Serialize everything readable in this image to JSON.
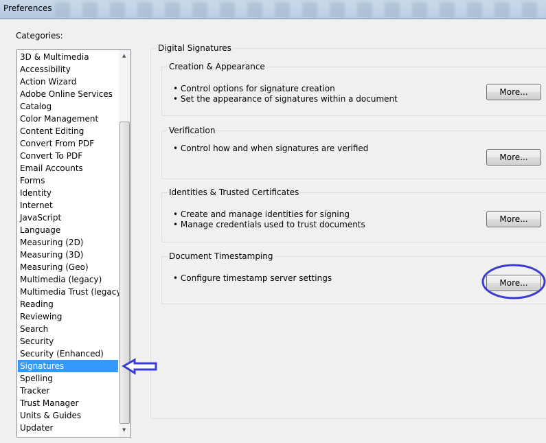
{
  "window": {
    "title": "Preferences"
  },
  "categories": {
    "label": "Categories:",
    "selected": "Signatures",
    "items": [
      "3D & Multimedia",
      "Accessibility",
      "Action Wizard",
      "Adobe Online Services",
      "Catalog",
      "Color Management",
      "Content Editing",
      "Convert From PDF",
      "Convert To PDF",
      "Email Accounts",
      "Forms",
      "Identity",
      "Internet",
      "JavaScript",
      "Language",
      "Measuring (2D)",
      "Measuring (3D)",
      "Measuring (Geo)",
      "Multimedia (legacy)",
      "Multimedia Trust (legacy)",
      "Reading",
      "Reviewing",
      "Search",
      "Security",
      "Security (Enhanced)",
      "Signatures",
      "Spelling",
      "Tracker",
      "Trust Manager",
      "Units & Guides",
      "Updater"
    ]
  },
  "panel": {
    "title": "Digital Signatures",
    "sections": [
      {
        "title": "Creation & Appearance",
        "bullets": [
          "• Control options for signature creation",
          "• Set the appearance of signatures within a document"
        ],
        "button": "More..."
      },
      {
        "title": "Verification",
        "bullets": [
          "• Control how and when signatures are verified"
        ],
        "button": "More..."
      },
      {
        "title": "Identities & Trusted Certificates",
        "bullets": [
          "• Create and manage identities for signing",
          "• Manage credentials used to trust documents"
        ],
        "button": "More..."
      },
      {
        "title": "Document Timestamping",
        "bullets": [
          "• Configure timestamp server settings"
        ],
        "button": "More..."
      }
    ]
  },
  "annotations": {
    "color": "#3a3ad0",
    "arrow": "points to Signatures",
    "ellipse": "circles Document Timestamping More button"
  }
}
